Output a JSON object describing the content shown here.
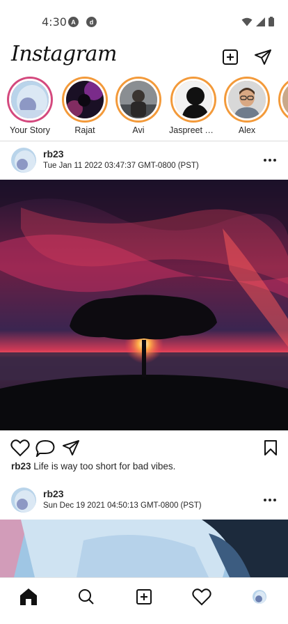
{
  "status_bar": {
    "time": "4:30",
    "app_icons": [
      "A",
      "d"
    ],
    "icons": [
      "wifi-icon",
      "cellular-signal-icon",
      "battery-icon"
    ]
  },
  "header": {
    "logo": "Instagram",
    "buttons": [
      "new-post-icon",
      "direct-message-icon"
    ]
  },
  "stories": [
    {
      "label": "Your Story",
      "own": true
    },
    {
      "label": "Rajat",
      "own": false
    },
    {
      "label": "Avi",
      "own": false
    },
    {
      "label": "Jaspreet R...",
      "own": false
    },
    {
      "label": "Alex",
      "own": false
    }
  ],
  "posts": [
    {
      "username": "rb23",
      "date": "Tue Jan 11 2022 03:47:37 GMT-0800 (PST)",
      "caption_user": "rb23",
      "caption_text": "Life is way too short for bad vibes."
    },
    {
      "username": "rb23",
      "date": "Sun Dec 19 2021 04:50:13 GMT-0800 (PST)"
    }
  ],
  "bottom_nav": [
    "home-icon",
    "search-icon",
    "add-post-icon",
    "activity-heart-icon",
    "profile-avatar"
  ],
  "colors": {
    "own_story_ring": "#d4497e",
    "story_ring": "#f39a3a",
    "text": "#262626",
    "divider": "#dbdbdb"
  }
}
